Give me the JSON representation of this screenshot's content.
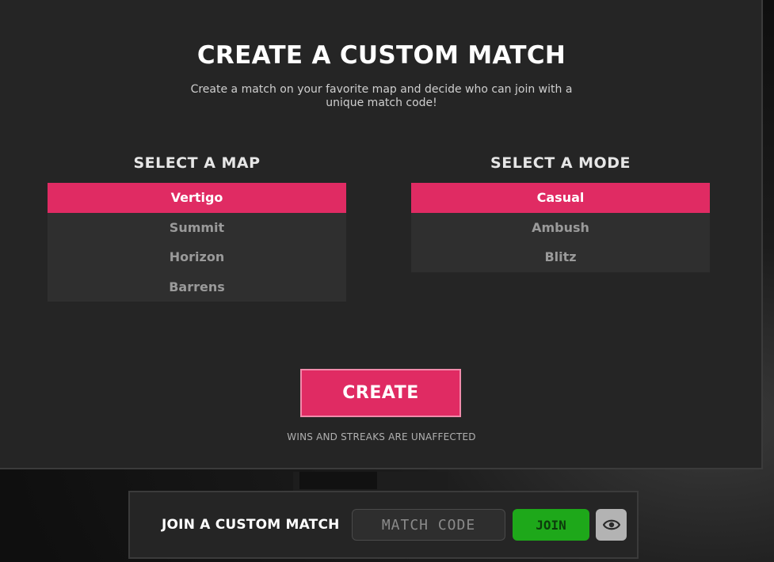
{
  "title": "CREATE A CUSTOM MATCH",
  "subtitle": "Create a match on your favorite map and decide who can join with a unique match code!",
  "map_section": {
    "heading": "SELECT A MAP",
    "items": [
      {
        "label": "Vertigo",
        "selected": true
      },
      {
        "label": "Summit",
        "selected": false
      },
      {
        "label": "Horizon",
        "selected": false
      },
      {
        "label": "Barrens",
        "selected": false
      }
    ]
  },
  "mode_section": {
    "heading": "SELECT A MODE",
    "items": [
      {
        "label": "Casual",
        "selected": true
      },
      {
        "label": "Ambush",
        "selected": false
      },
      {
        "label": "Blitz",
        "selected": false
      }
    ]
  },
  "create_button": {
    "label": "CREATE"
  },
  "disclaimer": "WINS AND STREAKS ARE UNAFFECTED",
  "join_bar": {
    "label": "JOIN A CUSTOM MATCH",
    "code_placeholder": "MATCH CODE",
    "join_label": "JOIN",
    "visibility_icon": "eye-icon"
  },
  "colors": {
    "accent": "#e02b63",
    "join_green": "#1ea81a",
    "panel": "#252525"
  }
}
